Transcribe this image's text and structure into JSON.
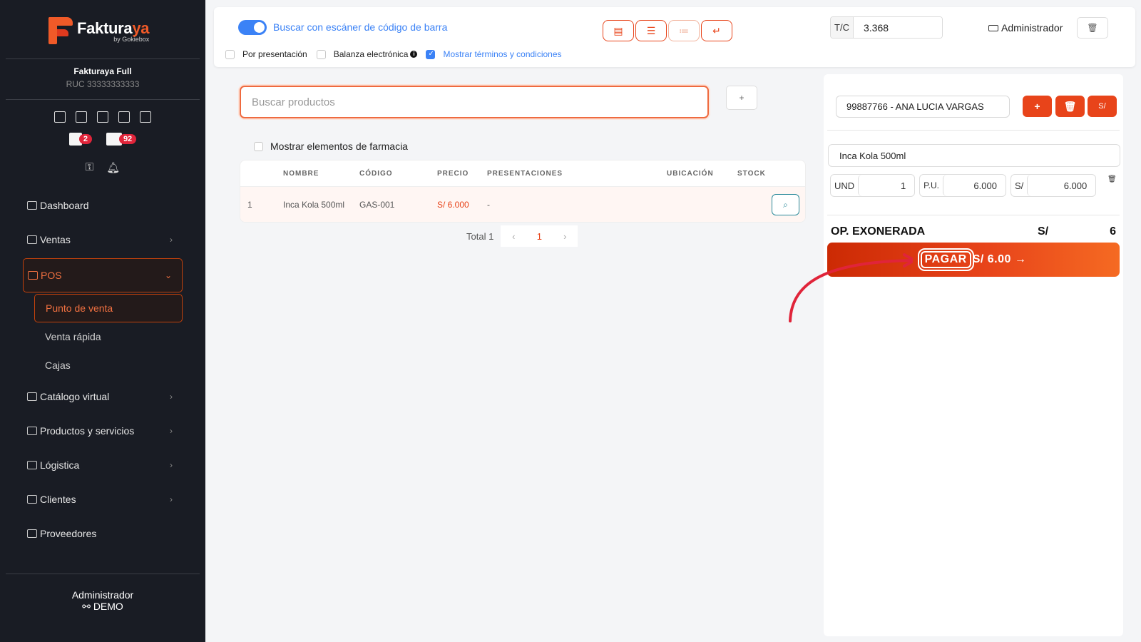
{
  "brand": {
    "name_main": "Faktura",
    "name_accent": "ya",
    "tagline": "by Gokiebox"
  },
  "company": {
    "name": "Fakturaya Full",
    "ruc": "RUC 33333333333"
  },
  "sidebar": {
    "badges": [
      {
        "icon": "calendar-x-icon",
        "count": "2"
      },
      {
        "icon": "box-icon",
        "count": "92"
      }
    ],
    "items": [
      {
        "label": "Dashboard",
        "icon": "dashboard-icon",
        "has_chevron": false
      },
      {
        "label": "Ventas",
        "icon": "receipt-icon",
        "has_chevron": true
      },
      {
        "label": "POS",
        "icon": "monitor-icon",
        "has_chevron": true,
        "active": true
      },
      {
        "label": "Catálogo virtual",
        "icon": "store-icon",
        "has_chevron": true
      },
      {
        "label": "Productos y servicios",
        "icon": "box-icon",
        "has_chevron": true
      },
      {
        "label": "Lógistica",
        "icon": "tag-icon",
        "has_chevron": true
      },
      {
        "label": "Clientes",
        "icon": "users-icon",
        "has_chevron": true
      },
      {
        "label": "Proveedores",
        "icon": "briefcase-icon",
        "has_chevron": false
      }
    ],
    "pos_subitems": [
      "Punto de venta",
      "Venta rápida",
      "Cajas"
    ],
    "footer": {
      "user": "Administrador",
      "mode": "DEMO"
    }
  },
  "topbar": {
    "scan_toggle_label": "Buscar con escáner de código de barra",
    "opt_presentation": "Por presentación",
    "opt_scale": "Balanza electrónica",
    "opt_terms": "Mostrar términos y condiciones",
    "tc_label": "T/C",
    "tc_value": "3.368",
    "user": "Administrador"
  },
  "search": {
    "placeholder": "Buscar productos",
    "add_label": "+",
    "pharma_label": "Mostrar elementos de farmacia"
  },
  "table": {
    "headers": {
      "nombre": "NOMBRE",
      "codigo": "CÓDIGO",
      "precio": "PRECIO",
      "presentaciones": "PRESENTACIONES",
      "ubicacion": "UBICACIÓN",
      "stock": "STOCK"
    },
    "rows": [
      {
        "idx": "1",
        "nombre": "Inca Kola 500ml",
        "codigo": "GAS-001",
        "precio": "S/ 6.000",
        "presentaciones": "-",
        "ubicacion": "",
        "stock": ""
      }
    ],
    "total_label": "Total 1",
    "current_page": "1"
  },
  "cart": {
    "client": "99887766 - ANA LUCIA VARGAS",
    "currency_btn": "S/",
    "item": {
      "name": "Inca Kola 500ml",
      "unit": "UND",
      "qty": "1",
      "pu_label": "P.U.",
      "pu": "6.000",
      "total_label": "S/",
      "total": "6.000"
    },
    "summary": {
      "label": "OP. EXONERADA",
      "currency": "S/",
      "amount": "6"
    },
    "pay": {
      "label": "PAGAR",
      "amount": "S/ 6.00 →"
    }
  },
  "colors": {
    "accent": "#e8441a",
    "sidebar_bg": "#191c24",
    "link_blue": "#3b82f6"
  }
}
